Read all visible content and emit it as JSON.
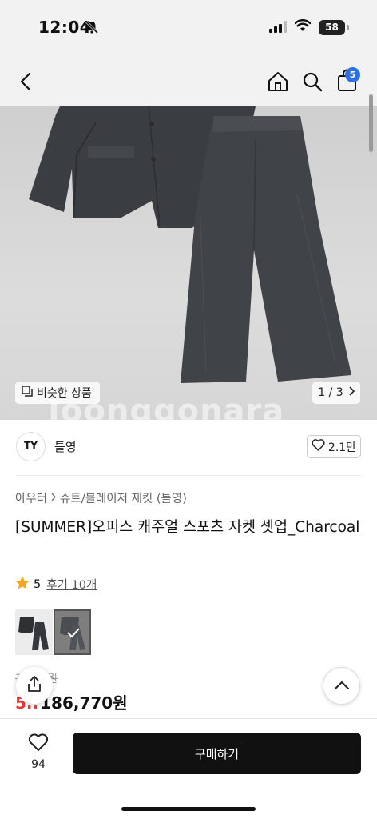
{
  "status_bar": {
    "time": "12:04",
    "battery": "58",
    "icons": [
      "bell-slash-icon",
      "signal-icon",
      "wifi-icon",
      "battery-icon"
    ]
  },
  "nav": {
    "icons": [
      "back-icon",
      "home-icon",
      "search-icon",
      "shopping-bag-icon"
    ],
    "cart_badge": "5",
    "badge_color": "#2f6fe4"
  },
  "hero": {
    "similar_label": "비슷한 상품",
    "page_indicator": "1 / 3",
    "watermark": "Joonggonara"
  },
  "shop": {
    "logo_text": "TY",
    "name": "틀영",
    "likes": "2.1만"
  },
  "product": {
    "breadcrumb": [
      "아우터",
      "슈트/블레이저 재킷 (틀영)"
    ],
    "title": "[SUMMER]오피스 캐주얼 스포츠 자켓 셋업_Charcoal",
    "rating": "5",
    "review_label": "후기 10개",
    "star_color": "#f5a623",
    "original_price": "3..,..0원",
    "discount": "5..",
    "price": "186,770원",
    "discount_color": "#e53935"
  },
  "bottom_bar": {
    "wish_count": "94",
    "buy_label": "구매하기"
  }
}
